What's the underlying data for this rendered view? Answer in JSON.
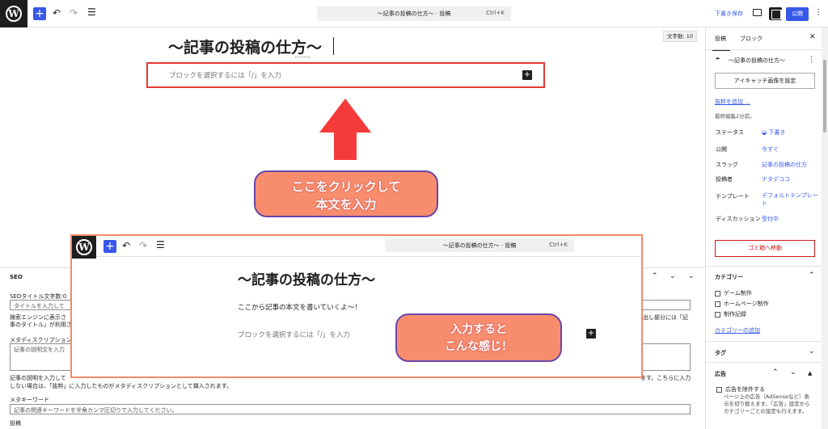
{
  "topbar": {
    "command": "〜記事の投稿の仕方〜 · 投稿",
    "shortcut": "Ctrl+K",
    "draft_save": "下書き保存",
    "publish": "公開"
  },
  "editor": {
    "word_count": "文字数: 10",
    "title": "〜記事の投稿の仕方〜",
    "block_placeholder": "ブロックを選択するには「/」を入力"
  },
  "annotations": {
    "callout1_line1": "ここをクリックして",
    "callout1_line2": "本文を入力",
    "callout2_line1": "入力すると",
    "callout2_line2": "こんな感じ！",
    "arrow_color": "#f53a3a",
    "callout_color": "#f88d6e"
  },
  "inset": {
    "command": "〜記事の投稿の仕方〜 · 投稿",
    "shortcut": "Ctrl+K",
    "title": "〜記事の投稿の仕方〜",
    "body_text": "ここから記事の本文を書いていくよ〜！",
    "block_placeholder": "ブロックを選択するには「/」を入力"
  },
  "seo": {
    "heading": "SEO",
    "title_count": "SEOタイトル文字数:0",
    "title_placeholder": "タイトルを入力して",
    "title_help1": "検索エンジンに表示さ",
    "title_help2": "事のタイトル」が利用さ",
    "title_help_right1": "出し部分には「記",
    "meta_desc_label": "メタディスクリプション",
    "meta_desc_placeholder": "記事の説明文を入力",
    "meta_desc_help1": "記事の説明を入力して",
    "meta_desc_help2": "しない場合は、「抜粋」に入力したものがメタディスクリプションとして挿入されます。",
    "meta_desc_help_right": "ます。こちらに入力",
    "keyword_label": "メタキーワード",
    "keyword_placeholder": "記事の関連キーワードを半角カンマ区切りで入力してください。",
    "post_label": "投稿"
  },
  "sidebar": {
    "tab_post": "投稿",
    "tab_block": "ブロック",
    "post_title": "〜記事の投稿の仕方〜",
    "featured_image": "アイキャッチ画像を設定",
    "add_excerpt": "抜粋を追加 ...",
    "last_edited": "最終編集2分前。",
    "rows": [
      {
        "label": "ステータス",
        "value": "下書き"
      },
      {
        "label": "公開",
        "value": "今すぐ"
      },
      {
        "label": "スラッグ",
        "value": "記事の投稿の仕方"
      },
      {
        "label": "投稿者",
        "value": "ナタデココ"
      },
      {
        "label": "テンプレート",
        "value": "デフォルトテンプレート"
      },
      {
        "label": "ディスカッション",
        "value": "受付中"
      }
    ],
    "trash": "ゴミ箱へ移動",
    "category_heading": "カテゴリー",
    "categories": [
      "ゲーム制作",
      "ホームページ制作",
      "制作記録"
    ],
    "add_category": "カテゴリーの追加",
    "tag_heading": "タグ",
    "ad_heading": "広告",
    "ad_exclude": "広告を除外する",
    "ad_help": "ページ上の広告（AdSenseなど）表示を切り替えます。「広告」設定からカテゴリーごとの設定も行えます。"
  }
}
